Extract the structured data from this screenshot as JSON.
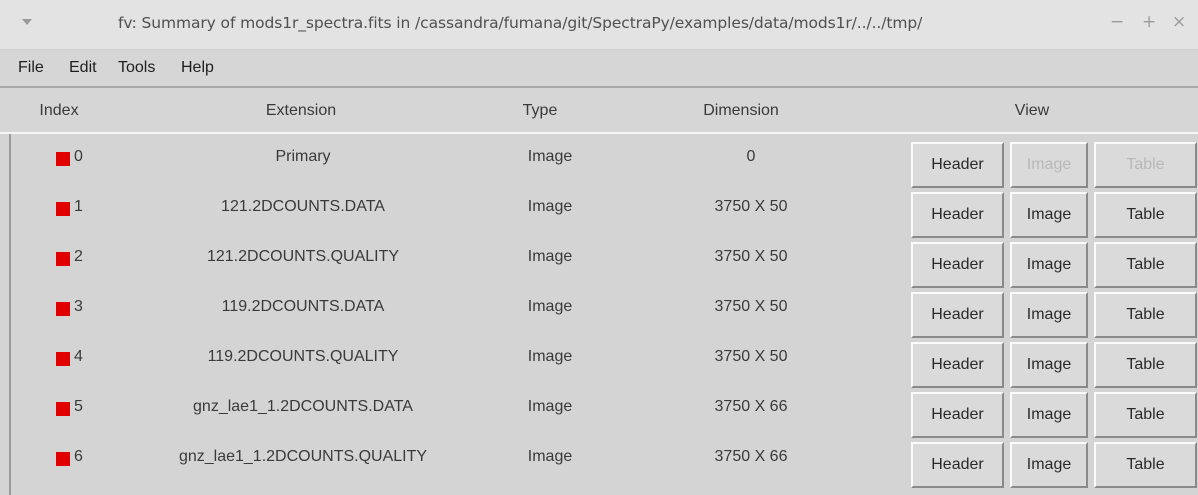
{
  "window": {
    "title": "fv: Summary of mods1r_spectra.fits in /cassandra/fumana/git/SpectraPy/examples/data/mods1r/../../tmp/",
    "controls": [
      "−",
      "+",
      "×"
    ]
  },
  "menu": [
    "File",
    "Edit",
    "Tools",
    "Help"
  ],
  "columns": {
    "index": "Index",
    "extension": "Extension",
    "type": "Type",
    "dimension": "Dimension",
    "view": "View"
  },
  "rows": [
    {
      "index": "0",
      "extension": "Primary",
      "type": "Image",
      "dimension": "0",
      "header": "Header",
      "image": "Image",
      "table": "Table",
      "image_enabled": false,
      "table_enabled": false
    },
    {
      "index": "1",
      "extension": "121.2DCOUNTS.DATA",
      "type": "Image",
      "dimension": "3750 X 50",
      "header": "Header",
      "image": "Image",
      "table": "Table",
      "image_enabled": true,
      "table_enabled": true
    },
    {
      "index": "2",
      "extension": "121.2DCOUNTS.QUALITY",
      "type": "Image",
      "dimension": "3750 X 50",
      "header": "Header",
      "image": "Image",
      "table": "Table",
      "image_enabled": true,
      "table_enabled": true
    },
    {
      "index": "3",
      "extension": "119.2DCOUNTS.DATA",
      "type": "Image",
      "dimension": "3750 X 50",
      "header": "Header",
      "image": "Image",
      "table": "Table",
      "image_enabled": true,
      "table_enabled": true
    },
    {
      "index": "4",
      "extension": "119.2DCOUNTS.QUALITY",
      "type": "Image",
      "dimension": "3750 X 50",
      "header": "Header",
      "image": "Image",
      "table": "Table",
      "image_enabled": true,
      "table_enabled": true
    },
    {
      "index": "5",
      "extension": "gnz_lae1_1.2DCOUNTS.DATA",
      "type": "Image",
      "dimension": "3750 X 66",
      "header": "Header",
      "image": "Image",
      "table": "Table",
      "image_enabled": true,
      "table_enabled": true
    },
    {
      "index": "6",
      "extension": "gnz_lae1_1.2DCOUNTS.QUALITY",
      "type": "Image",
      "dimension": "3750 X 66",
      "header": "Header",
      "image": "Image",
      "table": "Table",
      "image_enabled": true,
      "table_enabled": true
    }
  ],
  "colors": {
    "marker": "#e00000",
    "background": "#d4d4d4",
    "disabled_text": "#b8b8b8"
  }
}
